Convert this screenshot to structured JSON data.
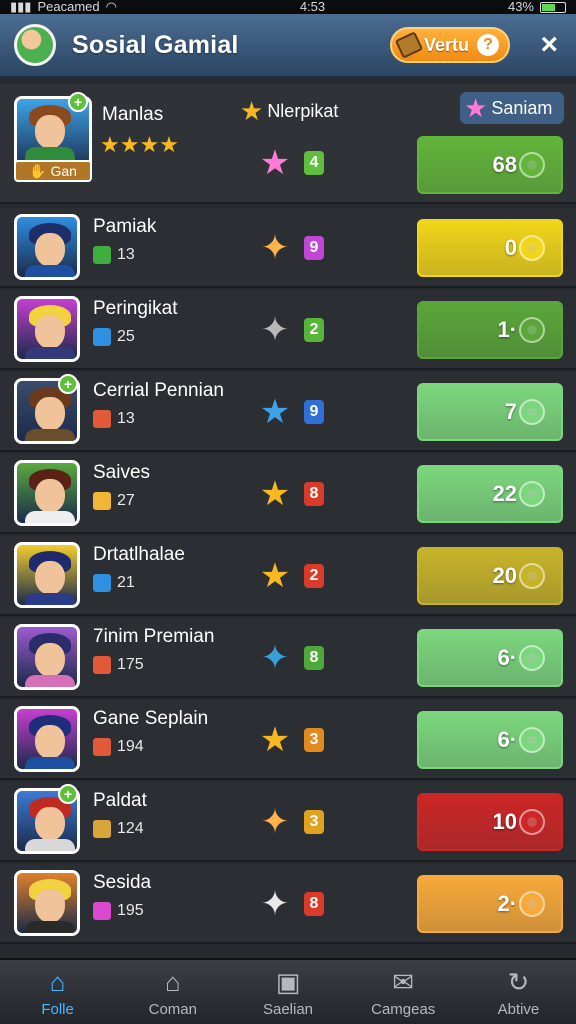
{
  "status": {
    "carrier": "Peacamed",
    "time": "4:53",
    "battery": "43%"
  },
  "header": {
    "title": "Sosial Gamial",
    "currency_label": "Vertu",
    "close": "×",
    "help": "?"
  },
  "top_labels": {
    "rank_label": "Nlerpikat",
    "save_label": "Saniam",
    "badge_label": "Gan"
  },
  "rows": [
    {
      "name": "Manlas",
      "stat": "",
      "level": "4",
      "score": "68",
      "score_color": "#62b43a",
      "badge_color": "#5fbf3a",
      "reward": "★",
      "reward_color": "#ff7bd5",
      "avatar_bg": "#3da3e8",
      "hair": "#8b4a1e",
      "shirt": "#2e8c3a",
      "stat_color": ""
    },
    {
      "name": "Pamiak",
      "stat": "13",
      "level": "9",
      "score": "0",
      "score_color": "#f1d51a",
      "badge_color": "#c046d6",
      "reward": "✦",
      "reward_color": "#ffb34a",
      "avatar_bg": "#2f8ee0",
      "hair": "#1c2f6b",
      "shirt": "#1f4fa0",
      "stat_color": "#3fae3f"
    },
    {
      "name": "Peringikat",
      "stat": "25",
      "level": "2",
      "score": "1·",
      "score_color": "#5aa63a",
      "badge_color": "#57b63a",
      "reward": "✦",
      "reward_color": "#b8b8b8",
      "avatar_bg": "#c53fd0",
      "hair": "#f2d23e",
      "shirt": "#333a7a",
      "stat_color": "#2f8fe0"
    },
    {
      "name": "Cerrial Pennian",
      "stat": "13",
      "level": "9",
      "score": "7",
      "score_color": "#7cd67d",
      "badge_color": "#2f6fd6",
      "reward": "★",
      "reward_color": "#3fa1e8",
      "avatar_bg": "#3c4c6a",
      "hair": "#6b3a1c",
      "shirt": "#6a4d2c",
      "stat_color": "#e05a3a"
    },
    {
      "name": "Saives",
      "stat": "27",
      "level": "8",
      "score": "22",
      "score_color": "#7cd67d",
      "badge_color": "#d93a2a",
      "reward": "★",
      "reward_color": "#f7b91f",
      "avatar_bg": "#5aa940",
      "hair": "#5a2214",
      "shirt": "#eeeeee",
      "stat_color": "#f2b636"
    },
    {
      "name": "Drtatlhalae",
      "stat": "21",
      "level": "2",
      "score": "20",
      "score_color": "#c7b32a",
      "badge_color": "#d93a2a",
      "reward": "★",
      "reward_color": "#f7b91f",
      "avatar_bg": "#f2cc2e",
      "hair": "#1e2a6b",
      "shirt": "#2a3b8a",
      "stat_color": "#2f8fe0"
    },
    {
      "name": "7inim Premian",
      "stat": "175",
      "level": "8",
      "score": "6·",
      "score_color": "#7cd67d",
      "badge_color": "#4fa83a",
      "reward": "✦",
      "reward_color": "#38a0d8",
      "avatar_bg": "#9c5bd0",
      "hair": "#2b2d6a",
      "shirt": "#d46fb8",
      "stat_color": "#e05a3a"
    },
    {
      "name": "Gane Seplain",
      "stat": "194",
      "level": "3",
      "score": "6·",
      "score_color": "#7cd67d",
      "badge_color": "#e08a1f",
      "reward": "★",
      "reward_color": "#f7b91f",
      "avatar_bg": "#c73fd0",
      "hair": "#1e2e7a",
      "shirt": "#1f4fa0",
      "stat_color": "#e05a3a"
    },
    {
      "name": "Paldat",
      "stat": "124",
      "level": "3",
      "score": "10",
      "score_color": "#cc2626",
      "badge_color": "#e0a21f",
      "reward": "✦",
      "reward_color": "#ffb34a",
      "avatar_bg": "#3d7bd6",
      "hair": "#c12a1f",
      "shirt": "#d8d8d8",
      "stat_color": "#d9a43a"
    },
    {
      "name": "Sesida",
      "stat": "195",
      "level": "8",
      "score": "2·",
      "score_color": "#f7a93a",
      "badge_color": "#d93a2a",
      "reward": "✦",
      "reward_color": "#e8e8e8",
      "avatar_bg": "#e0812a",
      "hair": "#f2d23e",
      "shirt": "#2a2a2a",
      "stat_color": "#d94ad0"
    }
  ],
  "nav": [
    {
      "label": "Folle",
      "icon": "home-icon",
      "glyph": "⌂",
      "active": true
    },
    {
      "label": "Coman",
      "icon": "house-icon",
      "glyph": "⌂",
      "active": false
    },
    {
      "label": "Saelian",
      "icon": "bag-icon",
      "glyph": "▣",
      "active": false
    },
    {
      "label": "Camgeas",
      "icon": "mail-icon",
      "glyph": "✉",
      "active": false
    },
    {
      "label": "Abtive",
      "icon": "refresh-icon",
      "glyph": "↻",
      "active": false
    }
  ]
}
